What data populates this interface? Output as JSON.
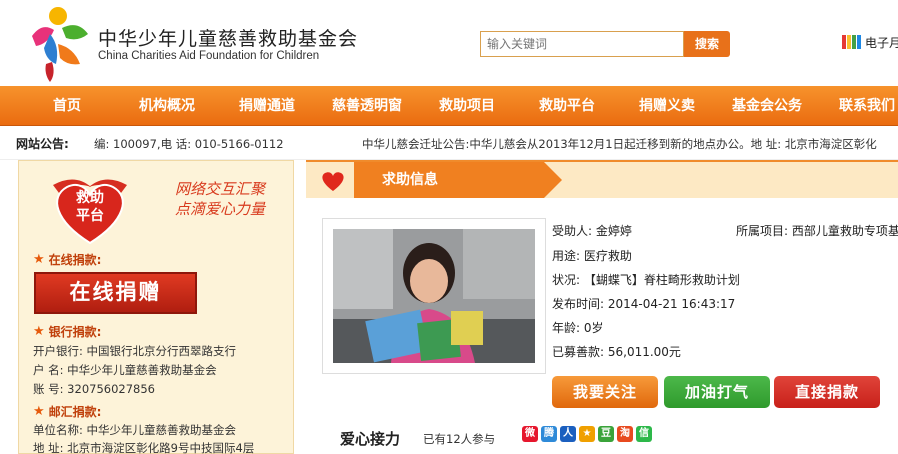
{
  "header": {
    "org_name_cn": "中华少年儿童慈善救助基金会",
    "org_name_en": "China Charities Aid Foundation for Children",
    "search_placeholder": "输入关键词",
    "search_button": "搜索",
    "ebook_label": "电子月"
  },
  "nav": {
    "items": [
      "首页",
      "机构概况",
      "捐赠通道",
      "慈善透明窗",
      "救助项目",
      "救助平台",
      "捐赠义卖",
      "基金会公务",
      "联系我们"
    ]
  },
  "notice": {
    "title": "网站公告:",
    "address": "编: 100097,电  话: 010-5166-0112",
    "scroll": "中华儿慈会迁址公告:中华儿慈会从2013年12月1日起迁移到新的地点办公。地  址: 北京市海淀区彰化"
  },
  "sidebar": {
    "banner_badge": "救助\n平台",
    "slogan_line1": "网络交互汇聚",
    "slogan_line2": "点滴爱心力量",
    "online_label": "在线捐款:",
    "online_button": "在线捐赠",
    "bank_label": "银行捐款:",
    "bank_lines": [
      "开户银行: 中国银行北京分行西翠路支行",
      "户  名: 中华少年儿童慈善救助基金会",
      "账  号: 320756027856"
    ],
    "post_label": "邮汇捐款:",
    "post_lines": [
      "单位名称: 中华少年儿童慈善救助基金会",
      "地  址: 北京市海淀区彰化路9号中技国际4层"
    ]
  },
  "main": {
    "tab_title": "求助信息",
    "recipient": "受助人: 金婷婷",
    "project": "所属项目: 西部儿童救助专项基",
    "purpose": "用途: 医疗救助",
    "status": "状况: 【蝴蝶飞】脊柱畸形救助计划",
    "published": "发布时间: 2014-04-21 16:43:17",
    "age": "年龄: 0岁",
    "raised": "已募善款: 56,011.00元",
    "btn_follow": "我要关注",
    "btn_cheer": "加油打气",
    "btn_donate": "直接捐款",
    "relay_title": "爱心接力",
    "relay_count": "已有12人参与"
  },
  "colors": {
    "accent_orange": "#ea6c10",
    "donate_red": "#c8201a",
    "cheer_green": "#2f9a2c"
  }
}
